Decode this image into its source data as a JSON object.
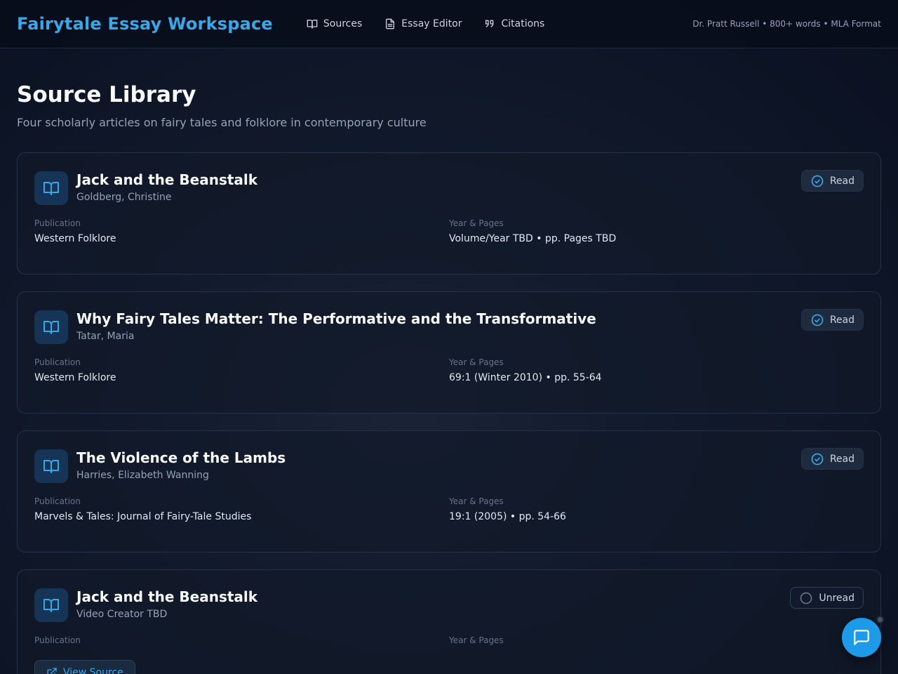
{
  "app": {
    "title": "Fairytale Essay Workspace",
    "meta": "Dr. Pratt Russell • 800+ words • MLA Format"
  },
  "nav": [
    {
      "label": "Sources",
      "icon": "book-open-icon"
    },
    {
      "label": "Essay Editor",
      "icon": "document-icon"
    },
    {
      "label": "Citations",
      "icon": "quote-icon"
    }
  ],
  "page": {
    "title": "Source Library",
    "subtitle": "Four scholarly articles on fairy tales and folklore in contemporary culture"
  },
  "labels": {
    "publication": "Publication",
    "year_pages": "Year & Pages",
    "view_source": "View Source"
  },
  "sources": [
    {
      "title": "Jack and the Beanstalk",
      "author": "Goldberg, Christine",
      "publication": "Western Folklore",
      "year_pages": "Volume/Year TBD • pp. Pages TBD",
      "status": "Read"
    },
    {
      "title": "Why Fairy Tales Matter: The Performative and the Transformative",
      "author": "Tatar, Maria",
      "publication": "Western Folklore",
      "year_pages": "69:1 (Winter 2010) • pp. 55-64",
      "status": "Read"
    },
    {
      "title": "The Violence of the Lambs",
      "author": "Harries, Elizabeth Wanning",
      "publication": "Marvels & Tales: Journal of Fairy-Tale Studies",
      "year_pages": "19:1 (2005) • pp. 54-66",
      "status": "Read"
    },
    {
      "title": "Jack and the Beanstalk",
      "author": "Video Creator TBD",
      "publication": "",
      "year_pages": "",
      "status": "Unread"
    }
  ],
  "colors": {
    "accent": "#38a8e8",
    "background": "#0b1120",
    "card": "#11192a",
    "fab": "#1d9be8"
  }
}
